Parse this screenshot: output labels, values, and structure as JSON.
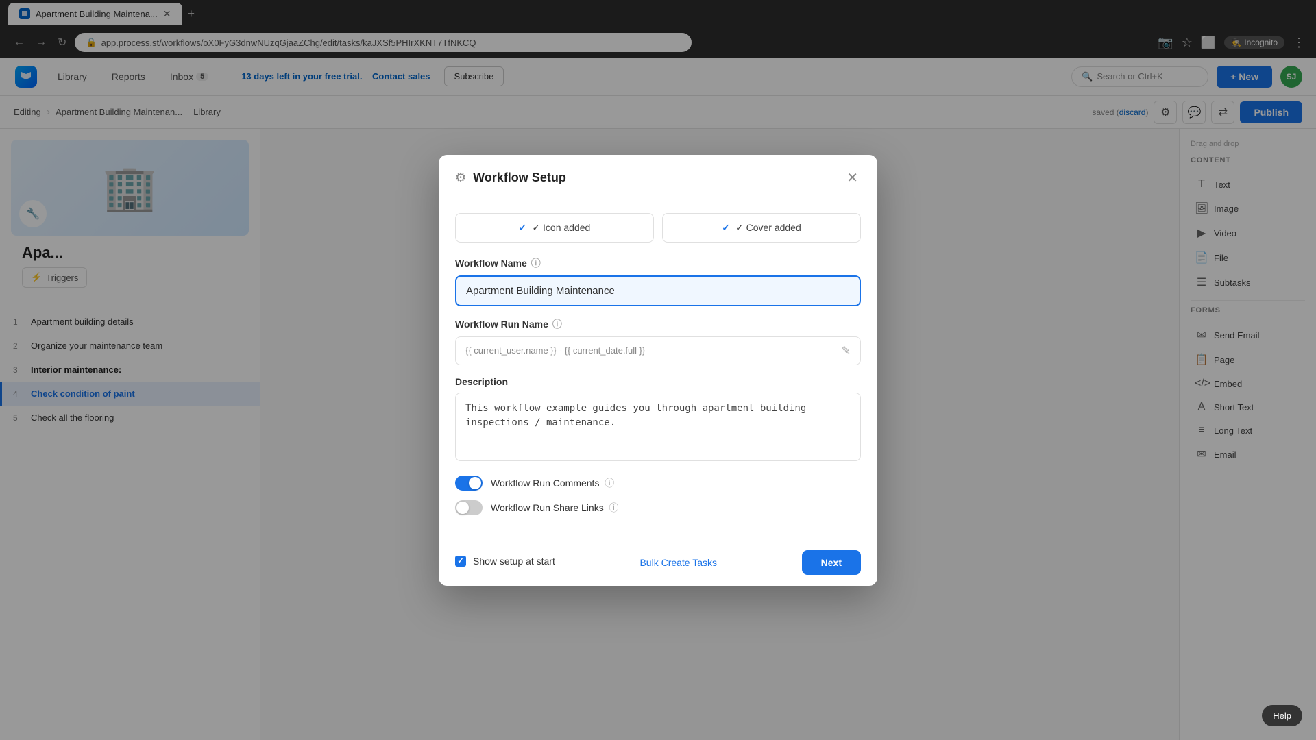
{
  "browser": {
    "tab_title": "Apartment Building Maintena...",
    "url": "app.process.st/workflows/oX0FyG3dnwNUzqGjaaZChg/edit/tasks/kaJXSf5PHIrXKNT7TfNKCQ",
    "incognito_label": "Incognito"
  },
  "header": {
    "library_label": "Library",
    "reports_label": "Reports",
    "inbox_label": "Inbox",
    "inbox_count": "5",
    "trial_text": "13 days left in your free trial.",
    "contact_sales_label": "Contact sales",
    "subscribe_label": "Subscribe",
    "search_placeholder": "Search or Ctrl+K",
    "new_button_label": "+ New",
    "avatar_initials": "SJ"
  },
  "editing_bar": {
    "editing_label": "Editing",
    "breadcrumb_text": "Apartment Building Maintenan...",
    "library_label": "Library",
    "saved_text": "saved (",
    "discard_label": "discard",
    "saved_suffix": ")",
    "publish_label": "Publish"
  },
  "sidebar": {
    "workflow_title": "Apa...",
    "triggers_label": "Triggers",
    "tasks": [
      {
        "number": "1",
        "label": "Apartment building details",
        "active": false,
        "section": false
      },
      {
        "number": "2",
        "label": "Organize your maintenance team",
        "active": false,
        "section": false
      },
      {
        "number": "3",
        "label": "Interior maintenance:",
        "active": false,
        "section": true
      },
      {
        "number": "4",
        "label": "Check condition of paint",
        "active": true,
        "section": false
      },
      {
        "number": "5",
        "label": "Check all the flooring",
        "active": false,
        "section": false
      }
    ]
  },
  "right_panel": {
    "drag_drop_hint": "Drag and drop",
    "content_title": "CONTENT",
    "content_items": [
      {
        "label": "Text",
        "icon": "T"
      },
      {
        "label": "Image",
        "icon": "🖼"
      },
      {
        "label": "Video",
        "icon": "▶"
      },
      {
        "label": "File",
        "icon": "📄"
      },
      {
        "label": "Subtasks",
        "icon": "☰"
      }
    ],
    "forms_title": "FORMS",
    "forms_items": [
      {
        "label": "Send Email",
        "icon": "✉"
      },
      {
        "label": "Page",
        "icon": "📋"
      },
      {
        "label": "Embed",
        "icon": "</>"
      },
      {
        "label": "Short Text",
        "icon": "A"
      },
      {
        "label": "Long Text",
        "icon": "≡"
      },
      {
        "label": "Email",
        "icon": "✉"
      }
    ]
  },
  "modal": {
    "title": "Workflow Setup",
    "icon_added_label": "✓ Icon added",
    "cover_added_label": "✓ Cover added",
    "workflow_name_label": "Workflow Name",
    "workflow_name_value": "Apartment Building Maintenance",
    "workflow_run_name_label": "Workflow Run Name",
    "workflow_run_name_placeholder": "{{ current_user.name }} - {{ current_date.full }}",
    "description_label": "Description",
    "description_value": "This workflow example guides you through apartment building inspections / maintenance.",
    "workflow_run_comments_label": "Workflow Run Comments",
    "workflow_run_share_links_label": "Workflow Run Share Links",
    "show_setup_label": "Show setup at start",
    "bulk_create_label": "Bulk Create Tasks",
    "next_label": "Next"
  },
  "help_label": "Help"
}
